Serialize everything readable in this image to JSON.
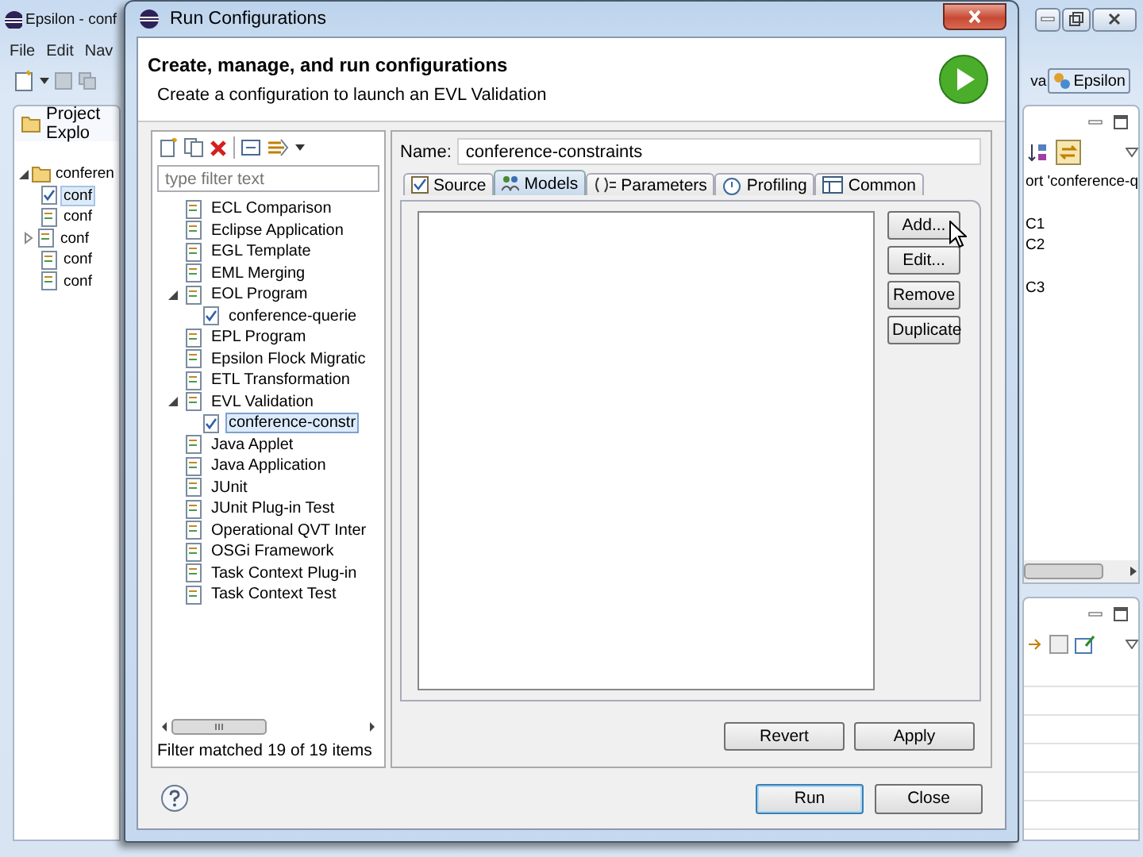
{
  "background_window": {
    "title": "Epsilon - conf",
    "menu": [
      "File",
      "Edit",
      "Nav"
    ],
    "explorer": {
      "tab": "Project Explo",
      "tree": [
        {
          "label": "conferen",
          "expanded": true,
          "children": [
            {
              "label": "conf",
              "selected": true,
              "expandable": false
            },
            {
              "label": "conf",
              "selected": false,
              "expandable": false
            },
            {
              "label": "conf",
              "selected": false,
              "expandable": true
            },
            {
              "label": "conf",
              "selected": false,
              "expandable": false
            },
            {
              "label": "conf",
              "selected": false,
              "expandable": false
            }
          ]
        }
      ]
    },
    "perspective_partial": "va",
    "perspective": "Epsilon",
    "outline": [
      [
        "ort 'conference-q"
      ],
      [
        "C1",
        "C2"
      ],
      [
        "C3"
      ]
    ]
  },
  "dialog": {
    "title": "Run Configurations",
    "heading": "Create, manage, and run configurations",
    "description": "Create a configuration to launch an EVL Validation",
    "filter": {
      "placeholder": "type filter text"
    },
    "tree": [
      {
        "label": "ECL Comparison",
        "selected": false
      },
      {
        "label": "Eclipse Application",
        "selected": false
      },
      {
        "label": "EGL Template",
        "selected": false
      },
      {
        "label": "EML Merging",
        "selected": false
      },
      {
        "label": "EOL Program",
        "selected": false,
        "expanded": true,
        "children": [
          {
            "label": "conference-querie",
            "selected": false
          }
        ]
      },
      {
        "label": "EPL Program",
        "selected": false
      },
      {
        "label": "Epsilon Flock Migratic",
        "selected": false
      },
      {
        "label": "ETL Transformation",
        "selected": false
      },
      {
        "label": "EVL Validation",
        "selected": false,
        "expanded": true,
        "children": [
          {
            "label": "conference-constr",
            "selected": true
          }
        ]
      },
      {
        "label": "Java Applet",
        "selected": false
      },
      {
        "label": "Java Application",
        "selected": false
      },
      {
        "label": "JUnit",
        "selected": false
      },
      {
        "label": "JUnit Plug-in Test",
        "selected": false
      },
      {
        "label": "Operational QVT Inter",
        "selected": false
      },
      {
        "label": "OSGi Framework",
        "selected": false
      },
      {
        "label": "Task Context Plug-in",
        "selected": false
      },
      {
        "label": "Task Context Test",
        "selected": false
      }
    ],
    "filter_status": "Filter matched 19 of 19 items",
    "name_label": "Name:",
    "name": "conference-constraints",
    "tabs": [
      {
        "label": "Source",
        "selected": false
      },
      {
        "label": "Models",
        "selected": true
      },
      {
        "label": "Parameters",
        "selected": false
      },
      {
        "label": "Profiling",
        "selected": false
      },
      {
        "label": "Common",
        "selected": false
      }
    ],
    "model_buttons": [
      "Add...",
      "Edit...",
      "Remove",
      "Duplicate"
    ],
    "revert": "Revert",
    "apply": "Apply",
    "run": "Run",
    "close": "Close"
  }
}
